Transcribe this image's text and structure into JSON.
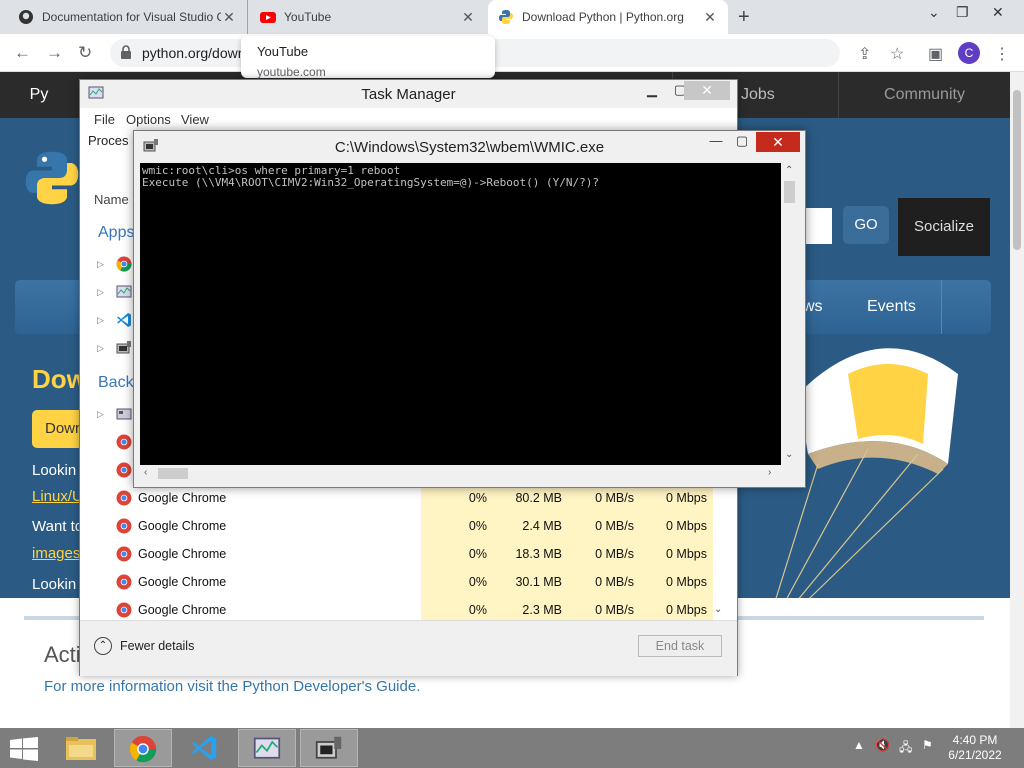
{
  "browser": {
    "tabs": [
      {
        "label": "Documentation for Visual Studio Code",
        "icon": "github-icon"
      },
      {
        "label": "YouTube",
        "icon": "youtube-icon"
      },
      {
        "label": "Download Python | Python.org",
        "icon": "python-icon"
      }
    ],
    "url": "python.org/downloads/",
    "profile_initial": "C",
    "hovercard": {
      "title": "YouTube",
      "domain": "youtube.com"
    }
  },
  "pyorg": {
    "top_nav": [
      "Py",
      "Jobs",
      "Community"
    ],
    "go_label": "GO",
    "socialize_label": "Socialize",
    "menu": [
      "ws",
      "Events"
    ],
    "heading": "Dow",
    "download_btn": "Dowr",
    "looking1": "Lookin",
    "linux_link": "Linux/U",
    "want": "Want to",
    "images_link": "images",
    "looking2": "Lookin",
    "acti_heading": "Acti",
    "dev_guide": "For more information visit the Python Developer's Guide."
  },
  "task_manager": {
    "title": "Task Manager",
    "menu": [
      "File",
      "Options",
      "View"
    ],
    "tab_processes": "Proces",
    "col_name": "Name",
    "group_apps": "Apps",
    "group_back": "Back",
    "rows": [
      {
        "name": "Google Chrome",
        "cpu": "0%",
        "mem": "80.2 MB",
        "disk": "0 MB/s",
        "net": "0 Mbps"
      },
      {
        "name": "Google Chrome",
        "cpu": "0%",
        "mem": "2.4 MB",
        "disk": "0 MB/s",
        "net": "0 Mbps"
      },
      {
        "name": "Google Chrome",
        "cpu": "0%",
        "mem": "18.3 MB",
        "disk": "0 MB/s",
        "net": "0 Mbps"
      },
      {
        "name": "Google Chrome",
        "cpu": "0%",
        "mem": "30.1 MB",
        "disk": "0 MB/s",
        "net": "0 Mbps"
      },
      {
        "name": "Google Chrome",
        "cpu": "0%",
        "mem": "2.3 MB",
        "disk": "0 MB/s",
        "net": "0 Mbps"
      }
    ],
    "fewer_details": "Fewer details",
    "end_task": "End task"
  },
  "console": {
    "title": "C:\\Windows\\System32\\wbem\\WMIC.exe",
    "line1": "wmic:root\\cli>os where primary=1 reboot",
    "line2": "Execute (\\\\VM4\\ROOT\\CIMV2:Win32_OperatingSystem=@)->Reboot() (Y/N/?)?"
  },
  "taskbar": {
    "time": "4:40 PM",
    "date": "6/21/2022",
    "apps": [
      "file-explorer-icon",
      "chrome-icon",
      "vscode-icon",
      "task-manager-icon",
      "wmic-icon"
    ]
  },
  "colors": {
    "python_blue": "#2b5b84",
    "python_yellow": "#ffd343",
    "close_red": "#c42b1c"
  }
}
